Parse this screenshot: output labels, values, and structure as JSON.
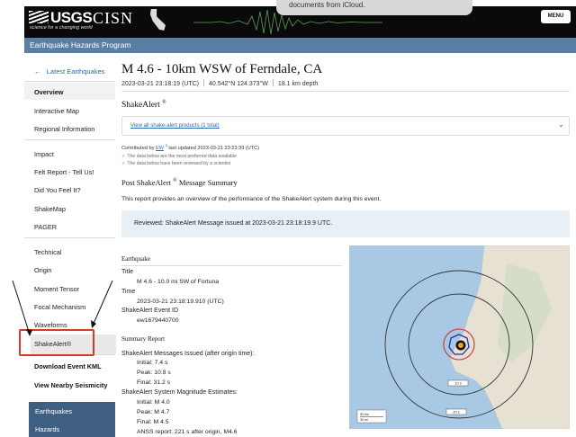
{
  "header": {
    "usgs": "USGS",
    "usgs_tagline": "science for a changing world",
    "cisn": "CISN",
    "notification": "documents from iCloud.",
    "menu_label": "MENU"
  },
  "subbar": {
    "title": "Earthquake Hazards Program"
  },
  "sidebar": {
    "back_label": "Latest Earthquakes",
    "overview": "Overview",
    "interactive_map": "Interactive Map",
    "regional_information": "Regional Information",
    "impact_heading": "Impact",
    "felt_report": "Felt Report - Tell Us!",
    "did_you_feel_it": "Did You Feel It?",
    "shakemap": "ShakeMap",
    "pager": "PAGER",
    "technical_heading": "Technical",
    "origin": "Origin",
    "moment_tensor": "Moment Tensor",
    "focal_mechanism": "Focal Mechanism",
    "waveforms": "Waveforms",
    "shakealert": "ShakeAlert®",
    "download_kml": "Download Event KML",
    "view_nearby": "View Nearby Seismicity",
    "earthquakes": "Earthquakes",
    "hazards": "Hazards"
  },
  "event": {
    "title": "M 4.6 - 10km WSW of Ferndale, CA",
    "time": "2023-03-21 23:18:19 (UTC)",
    "location": "40.542°N 124.373°W",
    "depth": "18.1 km depth"
  },
  "shakealert_section": {
    "heading": "ShakeAlert",
    "heading_mark": "®",
    "view_all_link": "View all shake-alert products (1 total)",
    "contrib_prefix": "Contributed by",
    "contrib_network": "EW",
    "contrib_count": "3",
    "contrib_suffix": "last updated 2023-03-21 23:23:39 (UTC)",
    "check1": "The data below are the most preferred data available",
    "check2": "The data below have been reviewed by a scientist"
  },
  "post_summary": {
    "heading": "Post ShakeAlert",
    "heading_mark": "®",
    "heading_suffix": "Message Summary",
    "intro": "This report provides an overview of the performance of the ShakeAlert system during this event.",
    "reviewed": "Reviewed: ShakeAlert Message issued at 2023-03-21 23:18:19.9 UTC."
  },
  "earthquake": {
    "heading": "Earthquake",
    "title_label": "Title",
    "title_value": "M 4.6 - 10.0 mi SW of Fortuna",
    "time_label": "Time",
    "time_value": "2023-03-21 23:18:19.910 (UTC)",
    "event_id_label": "ShakeAlert Event ID",
    "event_id_value": "ew1679440700"
  },
  "summary": {
    "heading": "Summary Report",
    "messages_label": "ShakeAlert Messages Issued (after origin time):",
    "initial": "Initial: 7.4 s",
    "peak": "Peak: 10.8 s",
    "final": "Final: 31.2 s",
    "mag_label": "ShakeAlert System Magnitude Estimates:",
    "mag_initial": "Initial: M 4.0",
    "mag_peak": "Peak: M 4.7",
    "mag_final": "Final: M 4.5",
    "anss": "ANSS report: 221 s after origin, M4.6"
  },
  "map": {
    "ring_label_1": "10 s",
    "ring_label_2": "20 s",
    "scale_top": "50 km",
    "scale_bottom": "30 mi",
    "colors": {
      "ocean": "#a8c8e4",
      "land": "#e6e1d2",
      "ring": "#333333",
      "red_ring": "#d03030",
      "blue_ring": "#2030b0"
    }
  },
  "colors": {
    "accent": "#5b7ea4",
    "link": "#2a6ab0",
    "highlight_box": "#d23a2a",
    "nav_dark": "#3f5f82"
  }
}
